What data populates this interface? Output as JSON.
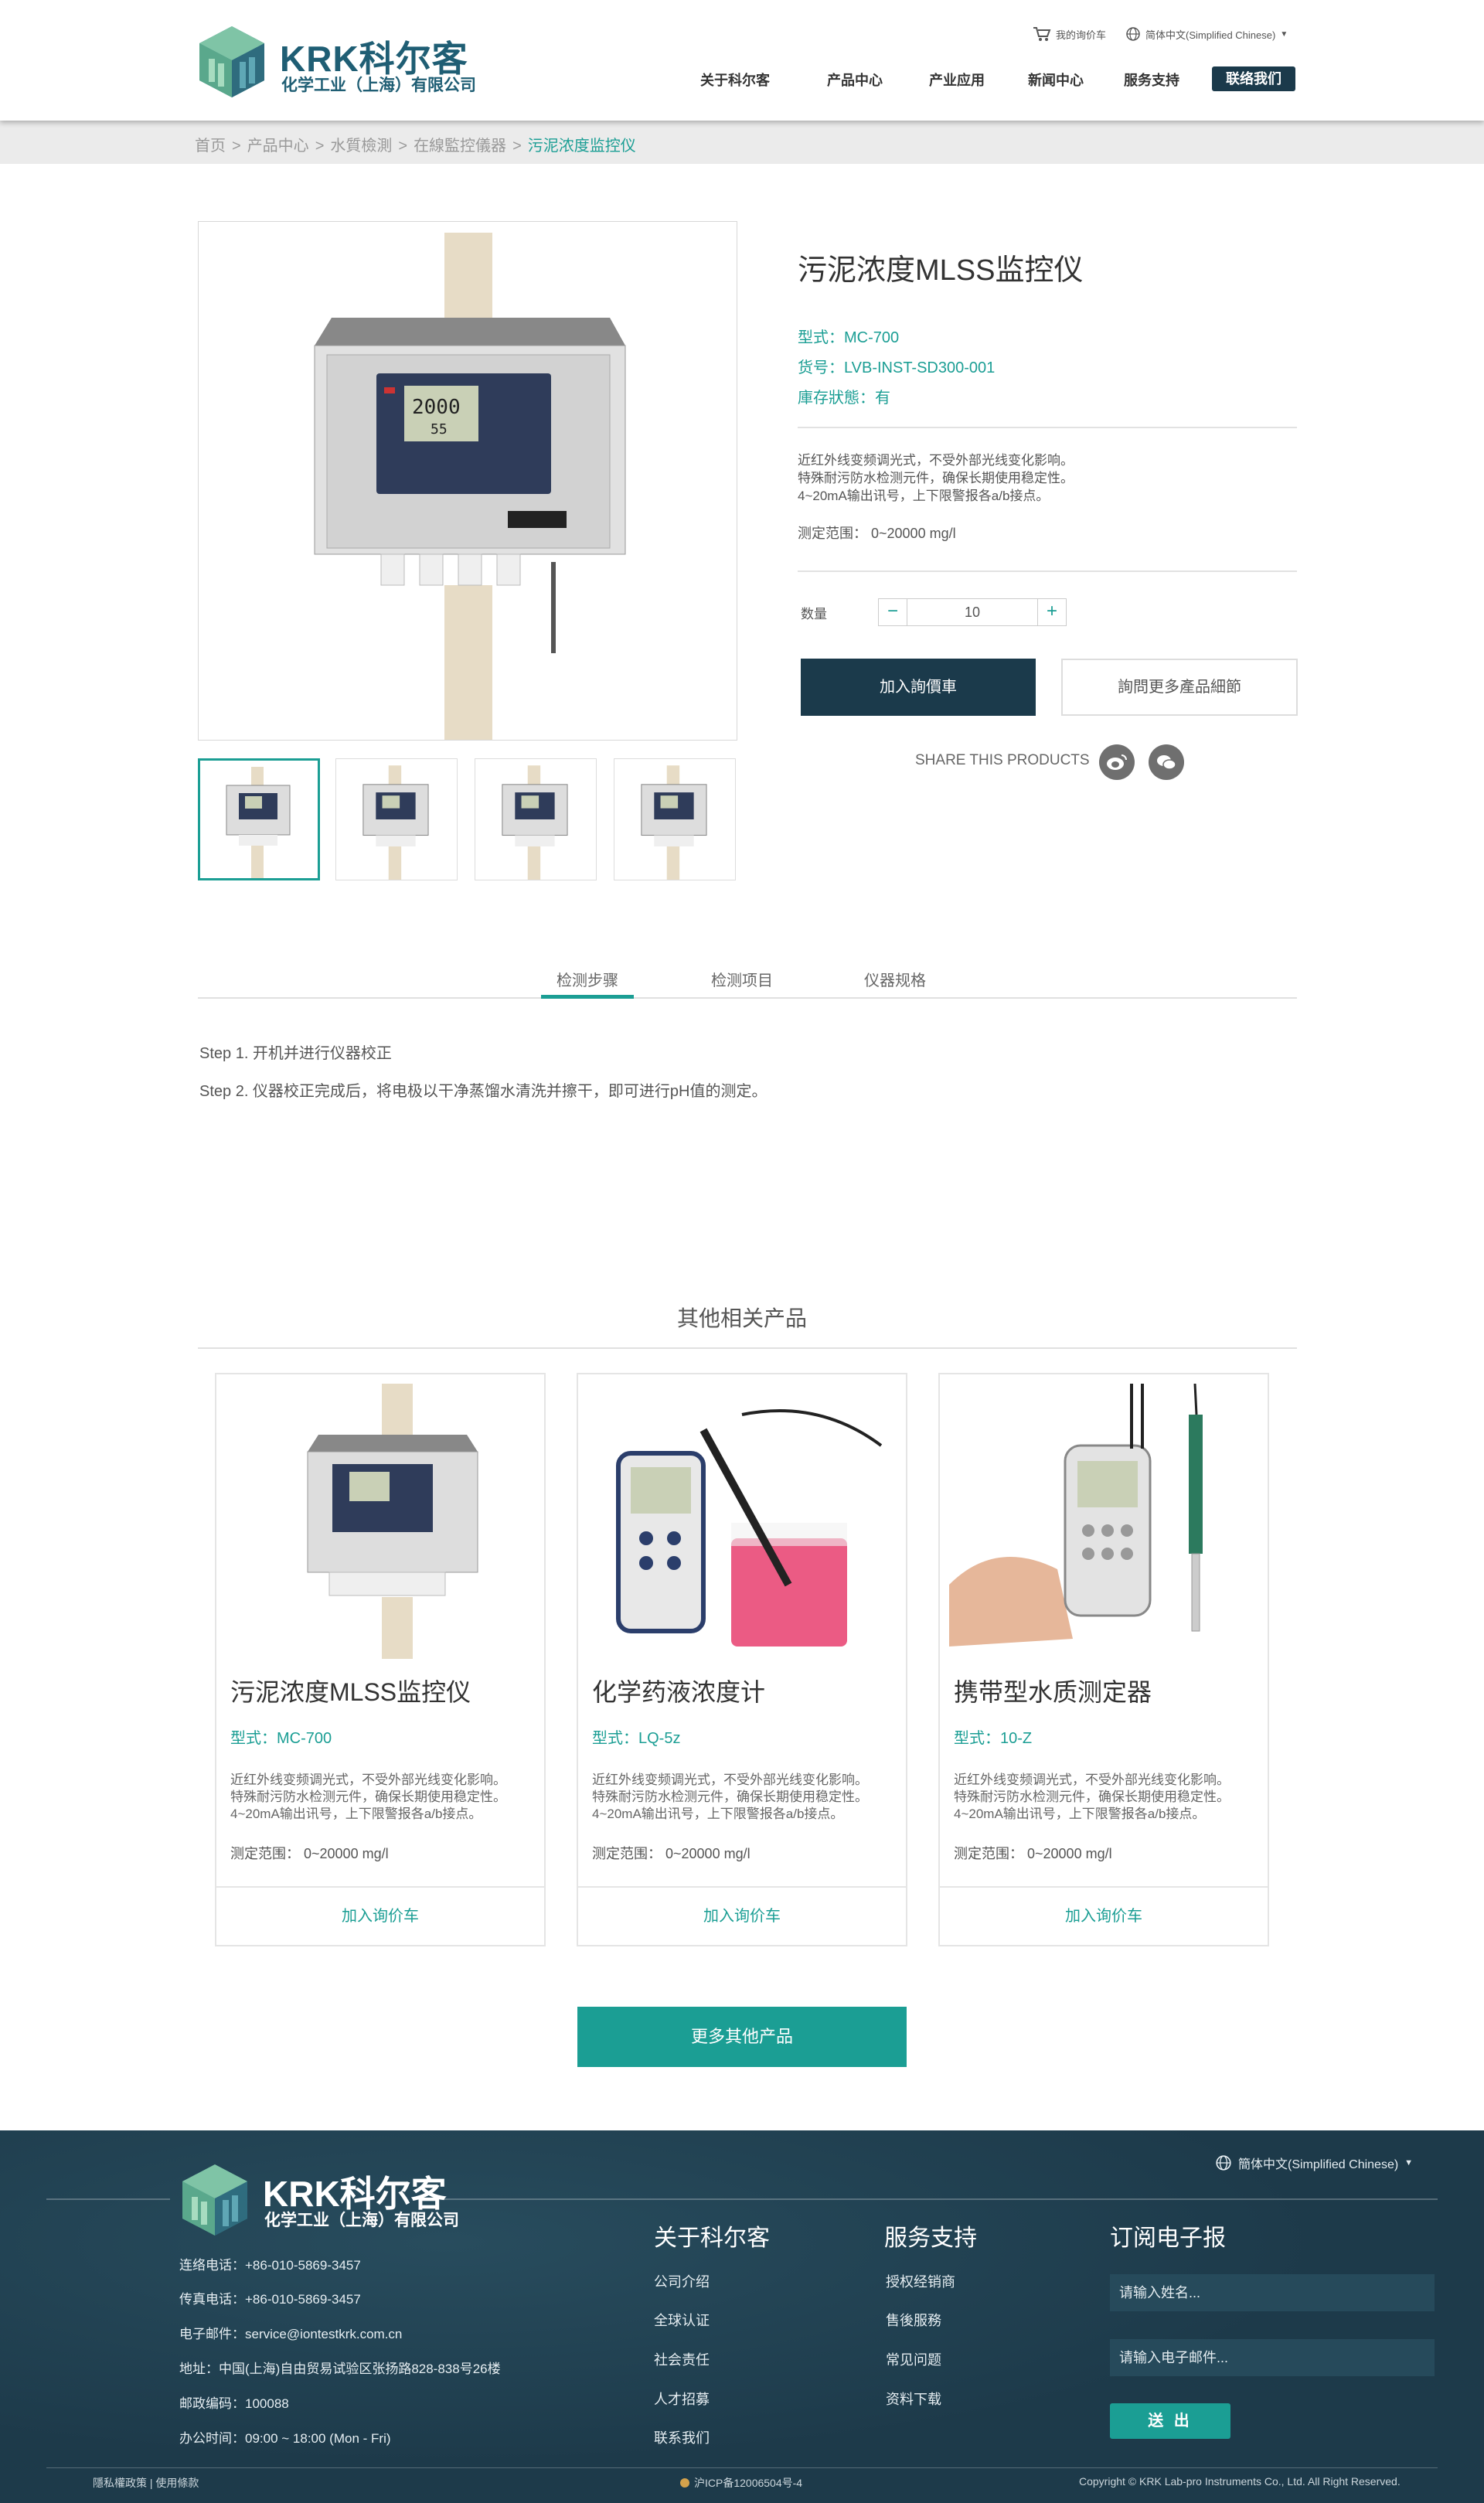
{
  "header": {
    "logo_main": "KRK科尔客",
    "logo_sub": "化学工业（上海）有限公司",
    "cart_label": "我的询价车",
    "language": "简体中文(Simplified Chinese)",
    "nav": [
      "关于科尔客",
      "产品中心",
      "产业应用",
      "新闻中心",
      "服务支持"
    ],
    "contact": "联络我们"
  },
  "breadcrumb": {
    "items": [
      "首页",
      "产品中心",
      "水質檢測",
      "在線監控儀器"
    ],
    "current": "污泥浓度监控仪",
    "separator": ">"
  },
  "product": {
    "title": "污泥浓度MLSS监控仪",
    "model": "型式：MC-700",
    "sku": "货号：LVB-INST-SD300-001",
    "stock": "庫存狀態：有",
    "desc": [
      "近红外线变频调光式，不受外部光线变化影响。",
      "特殊耐污防水检测元件，确保长期使用稳定性。",
      "4~20mA输出讯号，上下限警报各a/b接点。"
    ],
    "range": "测定范围： 0~20000 mg/l",
    "qty_label": "数量",
    "qty_value": "10",
    "minus": "−",
    "plus": "+",
    "add_cart": "加入詢價車",
    "inquire": "詢問更多產品細節",
    "share_label": "SHARE THIS PRODUCTS"
  },
  "tabs": [
    "检测步骤",
    "检测项目",
    "仪器规格"
  ],
  "steps": [
    "Step 1. 开机并进行仪器校正",
    "Step 2. 仪器校正完成后，将电极以干净蒸馏水清洗并擦干，即可进行pH值的测定。"
  ],
  "related": {
    "title": "其他相关产品",
    "cards": [
      {
        "name": "污泥浓度MLSS监控仪",
        "model": "型式：MC-700",
        "desc": [
          "近红外线变频调光式，不受外部光线变化影响。",
          "特殊耐污防水检测元件，确保长期使用稳定性。",
          "4~20mA输出讯号，上下限警报各a/b接点。"
        ],
        "range": "测定范围： 0~20000 mg/l",
        "button": "加入询价车"
      },
      {
        "name": "化学药液浓度计",
        "model": "型式：LQ-5z",
        "desc": [
          "近红外线变频调光式，不受外部光线变化影响。",
          "特殊耐污防水检测元件，确保长期使用稳定性。",
          "4~20mA输出讯号，上下限警报各a/b接点。"
        ],
        "range": "测定范围： 0~20000 mg/l",
        "button": "加入询价车"
      },
      {
        "name": "携带型水质测定器",
        "model": "型式：10-Z",
        "desc": [
          "近红外线变频调光式，不受外部光线变化影响。",
          "特殊耐污防水检测元件，确保长期使用稳定性。",
          "4~20mA输出讯号，上下限警报各a/b接点。"
        ],
        "range": "测定范围： 0~20000 mg/l",
        "button": "加入询价车"
      }
    ],
    "more": "更多其他产品"
  },
  "footer": {
    "logo_main": "KRK科尔客",
    "logo_sub": "化学工业（上海）有限公司",
    "language": "簡体中文(Simplified Chinese)",
    "info": [
      "连络电话：+86-010-5869-3457",
      "传真电话：+86-010-5869-3457",
      "电子邮件：service@iontestkrk.com.cn",
      "地址：中国(上海)自由贸易试验区张扬路828-838号26楼",
      "邮政编码：100088",
      "办公时间：09:00 ~ 18:00 (Mon - Fri)"
    ],
    "about_title": "关于科尔客",
    "about_links": [
      "公司介绍",
      "全球认证",
      "社会责任",
      "人才招募",
      "联系我们"
    ],
    "service_title": "服务支持",
    "service_links": [
      "授权经销商",
      "售後服務",
      "常见问题",
      "资料下载"
    ],
    "newsletter_title": "订阅电子报",
    "name_placeholder": "请输入姓名...",
    "email_placeholder": "请输入电子邮件...",
    "submit": "送 出",
    "privacy": "隱私權政策 | 使用條款",
    "icp": "沪ICP备12006504号-4",
    "copyright": "Copyright © KRK Lab-pro Instruments Co., Ltd. All Right Reserved."
  },
  "colors": {
    "accent": "#1b9e94",
    "navy": "#1b3a4b",
    "footer_bg": "#1d3a4a"
  }
}
